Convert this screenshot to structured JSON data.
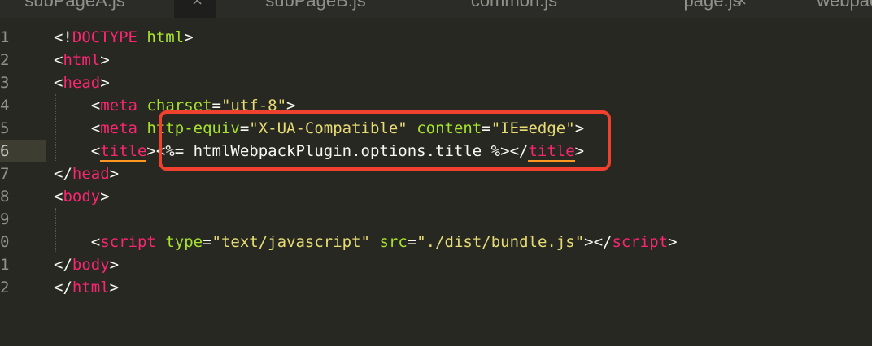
{
  "tabs": [
    {
      "label": "subPageA.js",
      "close": "×"
    },
    {
      "label": "subPageB.js",
      "close": "×"
    },
    {
      "label": "common.js",
      "close": "×"
    },
    {
      "label": "page.js",
      "close": "×"
    },
    {
      "label": "webpac"
    }
  ],
  "line_numbers": [
    "1",
    "2",
    "3",
    "4",
    "5",
    "6",
    "7",
    "8",
    "9",
    "0",
    "1",
    "2"
  ],
  "active_line_index": 5,
  "code": {
    "l1": {
      "open": "<!",
      "doctype": "DOCTYPE",
      "html": "html",
      "close": ">"
    },
    "l2": {
      "open": "<",
      "tag": "html",
      "close": ">"
    },
    "l3": {
      "open": "<",
      "tag": "head",
      "close": ">"
    },
    "l4": {
      "indent": "    ",
      "open": "<",
      "tag": "meta",
      "attr": "charset",
      "eq": "=",
      "val": "\"utf-8\"",
      "close": ">"
    },
    "l5": {
      "indent": "    ",
      "open": "<",
      "tag": "meta",
      "attr1": "http-equiv",
      "eq1": "=",
      "val1": "\"X-UA-Compatible\"",
      "attr2": "content",
      "eq2": "=",
      "val2": "\"IE=edge\"",
      "close": ">"
    },
    "l6": {
      "indent": "    ",
      "open": "<",
      "tag": "title",
      "gt": ">",
      "content": "<%= htmlWebpackPlugin.options.title %>",
      "close_open": "</",
      "close_tag": "title",
      "close": ">"
    },
    "l7": {
      "open": "</",
      "tag": "head",
      "close": ">"
    },
    "l8": {
      "open": "<",
      "tag": "body",
      "close": ">"
    },
    "l10": {
      "indent": "    ",
      "open": "<",
      "tag": "script",
      "attr1": "type",
      "eq1": "=",
      "val1": "\"text/javascript\"",
      "attr2": "src",
      "eq2": "=",
      "val2": "\"./dist/bundle.js\"",
      "gt": ">",
      "close_open": "</",
      "close_tag": "script",
      "close": ">"
    },
    "l11": {
      "open": "</",
      "tag": "body",
      "close": ">"
    },
    "l12": {
      "open": "</",
      "tag": "html",
      "close": ">"
    }
  },
  "colors": {
    "background": "#272822",
    "tag": "#f92672",
    "attribute": "#a6e22e",
    "string": "#e6db74",
    "plain": "#f8f8f2",
    "highlight_box": "#f0402e",
    "tag_match_underline": "#fd971f"
  }
}
